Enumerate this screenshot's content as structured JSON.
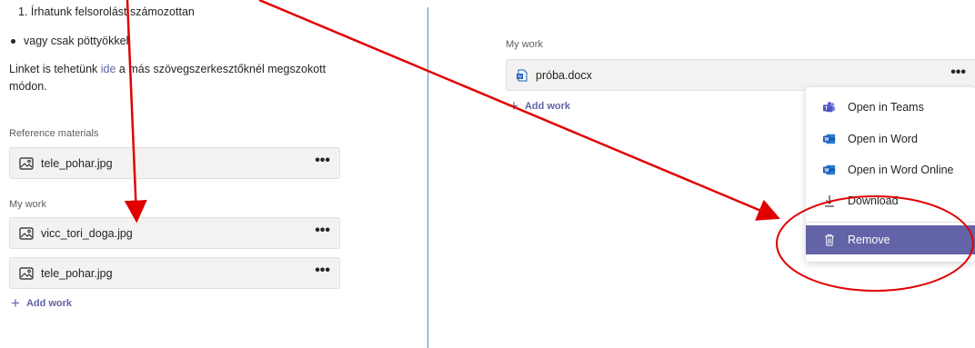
{
  "left": {
    "ordered_item": "1. Írhatunk felsorolást számozottan",
    "bullet_item": "vagy csak pöttyökkel",
    "paragraph_before": "Linket is tehetünk ",
    "paragraph_link": "ide",
    "paragraph_after": " a más szövegszerkesztőknél megszokott módon.",
    "reference_label": "Reference materials",
    "reference_files": [
      {
        "name": "tele_pohar.jpg"
      }
    ],
    "my_work_label": "My work",
    "my_work_files": [
      {
        "name": "vicc_tori_doga.jpg"
      },
      {
        "name": "tele_pohar.jpg"
      }
    ],
    "add_work": "Add work",
    "more": "•••"
  },
  "right": {
    "my_work_label": "My work",
    "file_name": "próba.docx",
    "add_work": "Add work",
    "more": "•••"
  },
  "menu": {
    "items": [
      {
        "label": "Open in Teams",
        "icon": "teams-icon"
      },
      {
        "label": "Open in Word",
        "icon": "word-icon"
      },
      {
        "label": "Open in Word Online",
        "icon": "word-icon"
      },
      {
        "label": "Download",
        "icon": "download-icon"
      },
      {
        "label": "Remove",
        "icon": "trash-icon"
      }
    ]
  },
  "colors": {
    "accent": "#6264a7",
    "annotation": "#e00000",
    "divider": "#4a8fe0"
  }
}
